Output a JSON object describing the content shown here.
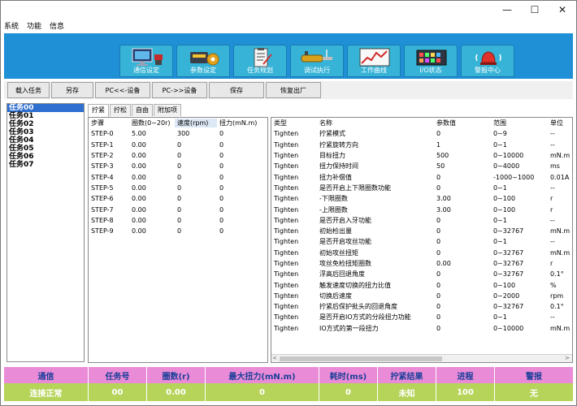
{
  "window_controls": [
    "—",
    "☐",
    "✕"
  ],
  "menu": [
    "系统",
    "功能",
    "信息"
  ],
  "modules": [
    {
      "label": "通信设定",
      "icon": "monitor-icon"
    },
    {
      "label": "参数设定",
      "icon": "gear-device-icon"
    },
    {
      "label": "任务规划",
      "icon": "clipboard-icon"
    },
    {
      "label": "调试执行",
      "icon": "wrench-tool-icon"
    },
    {
      "label": "工作曲线",
      "icon": "chart-icon"
    },
    {
      "label": "I/O状态",
      "icon": "io-board-icon"
    },
    {
      "label": "警报中心",
      "icon": "alarm-bell-icon"
    }
  ],
  "toolbar": [
    "载入任务",
    "另存",
    "PC<<-设备",
    "PC->>设备",
    "保存",
    "恢复出厂"
  ],
  "tasks": [
    "任务00",
    "任务01",
    "任务02",
    "任务03",
    "任务04",
    "任务05",
    "任务06",
    "任务07"
  ],
  "tabs": [
    "拧紧",
    "拧松",
    "自由",
    "附加项"
  ],
  "steps_table": {
    "headers": [
      "步骤",
      "圈数(0~20r)",
      "速度(rpm)",
      "扭力(mN.m)"
    ],
    "rows": [
      [
        "STEP-0",
        "5.00",
        "300",
        "0"
      ],
      [
        "STEP-1",
        "0.00",
        "0",
        "0"
      ],
      [
        "STEP-2",
        "0.00",
        "0",
        "0"
      ],
      [
        "STEP-3",
        "0.00",
        "0",
        "0"
      ],
      [
        "STEP-4",
        "0.00",
        "0",
        "0"
      ],
      [
        "STEP-5",
        "0.00",
        "0",
        "0"
      ],
      [
        "STEP-6",
        "0.00",
        "0",
        "0"
      ],
      [
        "STEP-7",
        "0.00",
        "0",
        "0"
      ],
      [
        "STEP-8",
        "0.00",
        "0",
        "0"
      ],
      [
        "STEP-9",
        "0.00",
        "0",
        "0"
      ]
    ]
  },
  "params_table": {
    "headers": [
      "类型",
      "名称",
      "参数值",
      "范围",
      "单位"
    ],
    "rows": [
      [
        "Tighten",
        "拧紧模式",
        "0",
        "0~9",
        "--"
      ],
      [
        "Tighten",
        "拧紧旋转方向",
        "1",
        "0~1",
        "--"
      ],
      [
        "Tighten",
        "目标扭力",
        "500",
        "0~10000",
        "mN.m"
      ],
      [
        "Tighten",
        "扭力保持时间",
        "50",
        "0~4000",
        "ms"
      ],
      [
        "Tighten",
        "扭力补偿值",
        "0",
        "-1000~1000",
        "0.01A"
      ],
      [
        "Tighten",
        "是否开启上下限圈数功能",
        "0",
        "0~1",
        "--"
      ],
      [
        "Tighten",
        "-下限圈数",
        "3.00",
        "0~100",
        "r"
      ],
      [
        "Tighten",
        "-上限圈数",
        "3.00",
        "0~100",
        "r"
      ],
      [
        "Tighten",
        "是否开启入牙功能",
        "0",
        "0~1",
        "--"
      ],
      [
        "Tighten",
        "初始检出量",
        "0",
        "0~32767",
        "mN.m"
      ],
      [
        "Tighten",
        "是否开启攻丝功能",
        "0",
        "0~1",
        "--"
      ],
      [
        "Tighten",
        "初始攻丝扭矩",
        "0",
        "0~32767",
        "mN.m"
      ],
      [
        "Tighten",
        "攻丝免检扭矩圈数",
        "0.00",
        "0~32767",
        "r"
      ],
      [
        "Tighten",
        "浮高后回退角度",
        "0",
        "0~32767",
        "0.1°"
      ],
      [
        "Tighten",
        "触发速度切换的扭力比值",
        "0",
        "0~100",
        "%"
      ],
      [
        "Tighten",
        "切换后速度",
        "0",
        "0~2000",
        "rpm"
      ],
      [
        "Tighten",
        "拧紧后保护批头的回退角度",
        "0",
        "0~32767",
        "0.1°"
      ],
      [
        "Tighten",
        "是否开启IO方式的分段扭力功能",
        "0",
        "0~1",
        "--"
      ],
      [
        "Tighten",
        "IO方式的第一段扭力",
        "0",
        "0~10000",
        "mN.m"
      ]
    ]
  },
  "scroll_arrows": [
    "<",
    ">"
  ],
  "status": {
    "headers": [
      "通信",
      "任务号",
      "圈数(r)",
      "最大扭力(mN.m)",
      "耗时(ms)",
      "拧紧结果",
      "进程",
      "警报"
    ],
    "values": [
      "连接正常",
      "00",
      "0.00",
      "0",
      "0",
      "未知",
      "100",
      "无"
    ]
  },
  "colors": {
    "module_bar": "#1f8fd6",
    "module_tab": "#36b3d6",
    "task_selected": "#2f6fd0",
    "status_header": "#e98bd6",
    "status_header_text": "#1a3f9a",
    "status_values": "#b6d45a"
  }
}
